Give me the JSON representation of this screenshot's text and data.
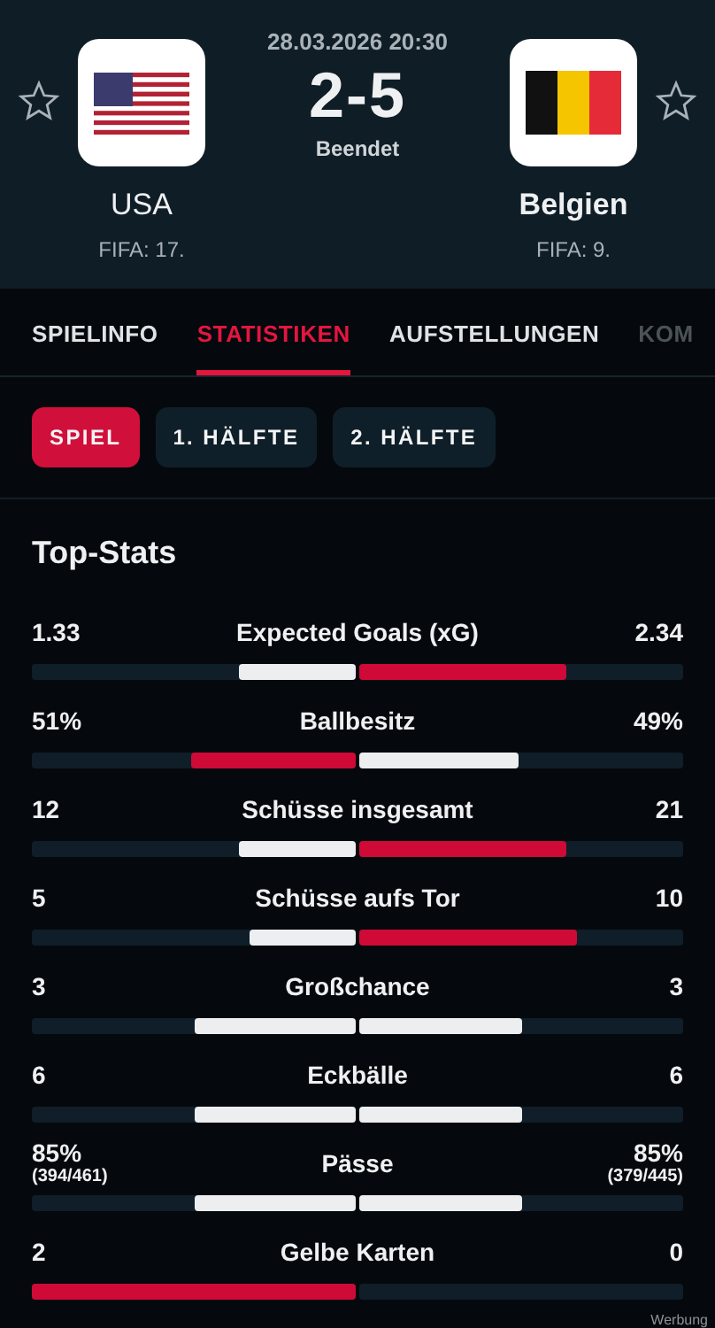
{
  "match": {
    "datetime": "28.03.2026 20:30",
    "score": "2-5",
    "status": "Beendet",
    "home": {
      "name": "USA",
      "rank": "FIFA: 17.",
      "logo": {
        "kind": "usa"
      },
      "favorite": false
    },
    "away": {
      "name": "Belgien",
      "rank": "FIFA: 9.",
      "logo": {
        "kind": "belgium"
      },
      "favorite": false
    }
  },
  "tabs": [
    {
      "label": "SPIELINFO",
      "selected": false
    },
    {
      "label": "STATISTIKEN",
      "selected": true
    },
    {
      "label": "AUFSTELLUNGEN",
      "selected": false
    },
    {
      "label": "KOM",
      "selected": false
    }
  ],
  "periods": [
    {
      "label": "SPIEL",
      "selected": true
    },
    {
      "label": "1. HÄLFTE",
      "selected": false
    },
    {
      "label": "2. HÄLFTE",
      "selected": false
    }
  ],
  "section_title": "Top-Stats",
  "stats": [
    {
      "label": "Expected Goals (xG)",
      "home": {
        "value": "1.33",
        "level": 0.36,
        "leading": false
      },
      "away": {
        "value": "2.34",
        "level": 0.64,
        "leading": true
      }
    },
    {
      "label": "Ballbesitz",
      "home": {
        "value": "51%",
        "level": 0.51,
        "leading": true
      },
      "away": {
        "value": "49%",
        "level": 0.49,
        "leading": false
      }
    },
    {
      "label": "Schüsse insgesamt",
      "home": {
        "value": "12",
        "level": 0.36,
        "leading": false
      },
      "away": {
        "value": "21",
        "level": 0.64,
        "leading": true
      }
    },
    {
      "label": "Schüsse aufs Tor",
      "home": {
        "value": "5",
        "level": 0.33,
        "leading": false
      },
      "away": {
        "value": "10",
        "level": 0.67,
        "leading": true
      }
    },
    {
      "label": "Großchance",
      "home": {
        "value": "3",
        "level": 0.5,
        "leading": false
      },
      "away": {
        "value": "3",
        "level": 0.5,
        "leading": false
      }
    },
    {
      "label": "Eckbälle",
      "home": {
        "value": "6",
        "level": 0.5,
        "leading": false
      },
      "away": {
        "value": "6",
        "level": 0.5,
        "leading": false
      }
    },
    {
      "label": "Pässe",
      "home": {
        "value": "85%",
        "sub": "(394/461)",
        "level": 0.5,
        "leading": false
      },
      "away": {
        "value": "85%",
        "sub": "(379/445)",
        "level": 0.5,
        "leading": false
      }
    },
    {
      "label": "Gelbe Karten",
      "home": {
        "value": "2",
        "level": 1,
        "leading": true
      },
      "away": {
        "value": "0",
        "level": 0
      }
    }
  ],
  "ad_label": "Werbung"
}
